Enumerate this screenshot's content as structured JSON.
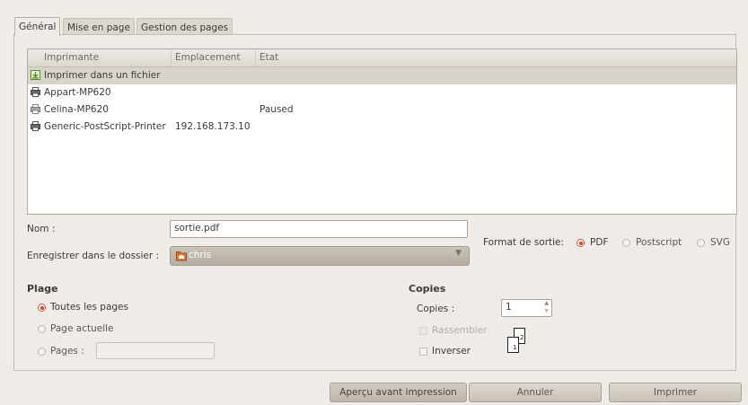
{
  "tabs": [
    "Général",
    "Mise en page",
    "Gestion des pages"
  ],
  "printer_table": {
    "headers": [
      "Imprimante",
      "Emplacement",
      "Etat"
    ],
    "rows": [
      {
        "name": "Imprimer dans un fichier",
        "location": "",
        "state": "",
        "icon": "file-printer-icon",
        "selected": true
      },
      {
        "name": "Appart-MP620",
        "location": "",
        "state": "",
        "icon": "printer-icon",
        "selected": false
      },
      {
        "name": "Celina-MP620",
        "location": "",
        "state": "Paused",
        "icon": "printer-paused-icon",
        "selected": false
      },
      {
        "name": "Generic-PostScript-Printer",
        "location": "192.168.173.10",
        "state": "",
        "icon": "printer-icon",
        "selected": false
      }
    ]
  },
  "form": {
    "name_label": "Nom :",
    "name_value": "sortie.pdf",
    "folder_label": "Enregistrer dans le dossier :",
    "folder_value": "chris",
    "format_label": "Format de sortie:",
    "formats": [
      "PDF",
      "Postscript",
      "SVG"
    ],
    "format_selected": "PDF"
  },
  "range": {
    "title": "Plage",
    "options": [
      "Toutes les pages",
      "Page actuelle",
      "Pages :"
    ],
    "selected": "Toutes les pages",
    "pages_value": ""
  },
  "copies": {
    "title": "Copies",
    "label": "Copies :",
    "value": "1",
    "collate_label": "Rassembler",
    "reverse_label": "Inverser"
  },
  "buttons": {
    "preview": "Aperçu avant impression",
    "cancel": "Annuler",
    "print": "Imprimer"
  },
  "colors": {
    "accent": "#dd4814",
    "background": "#efebe7"
  }
}
